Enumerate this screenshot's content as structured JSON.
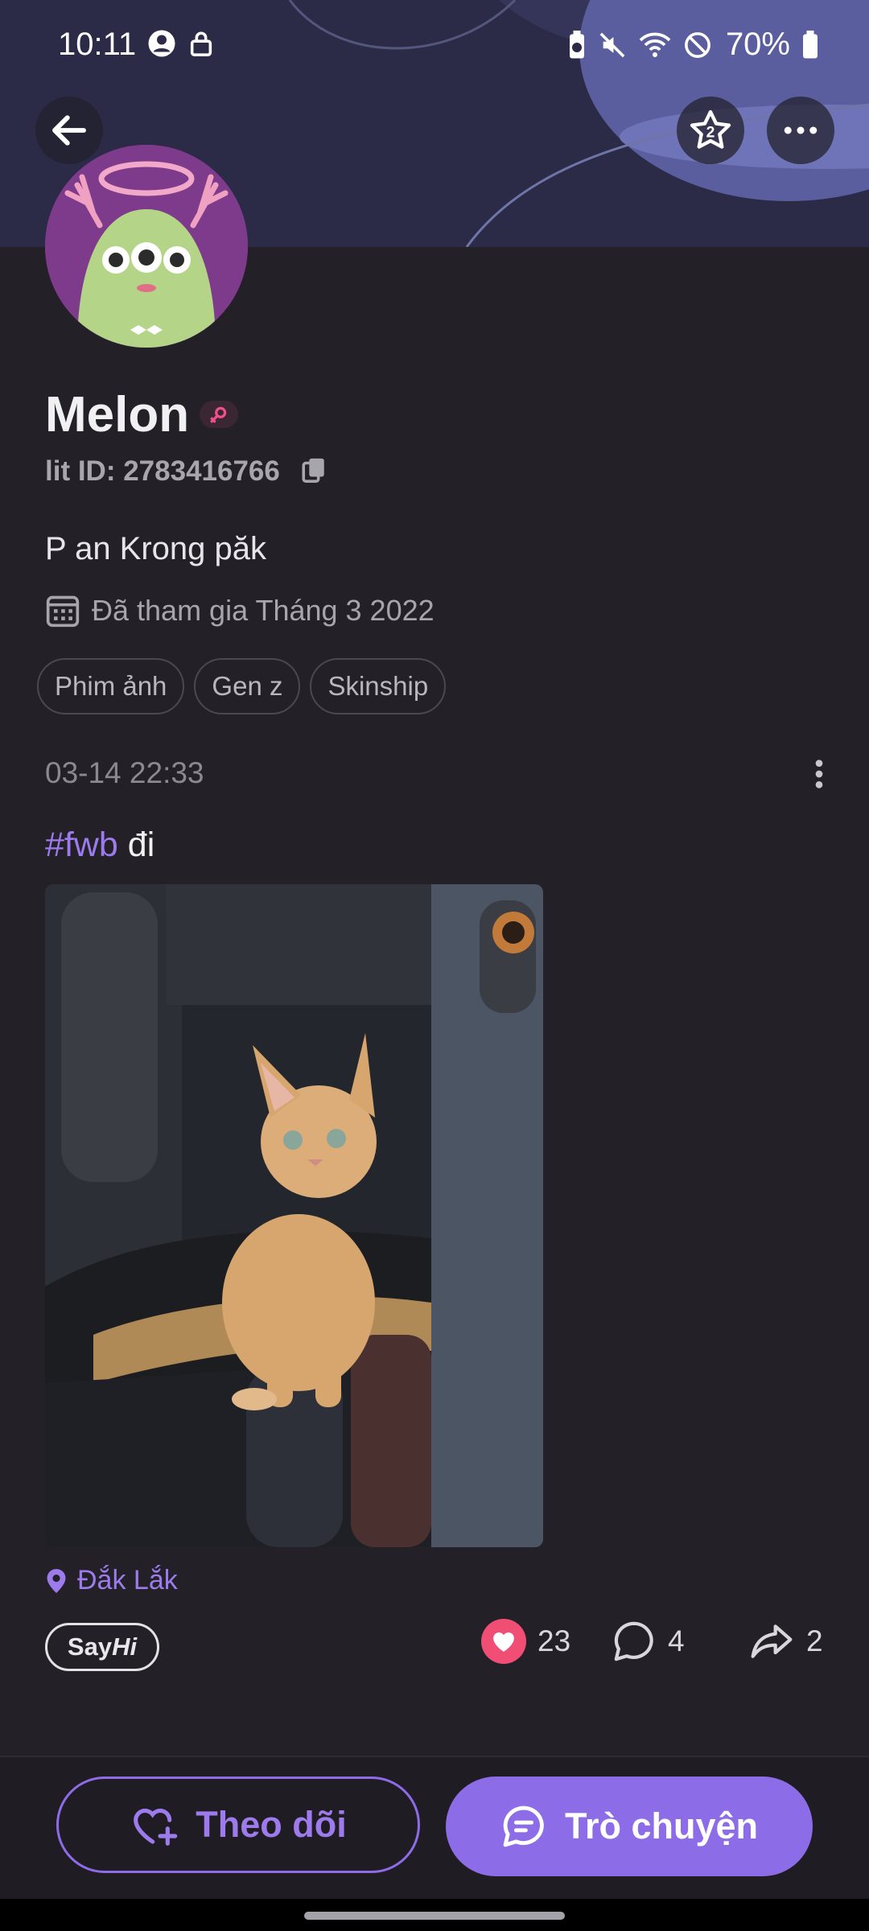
{
  "status_bar": {
    "time": "10:11",
    "battery": "70%"
  },
  "header": {
    "back_icon": "arrow-left-icon",
    "favorite_icon": "star-icon",
    "more_icon": "more-horizontal-icon"
  },
  "profile": {
    "name": "Melon",
    "lit_id": "lit ID: 2783416766",
    "bio": "P an Krong păk",
    "joined": "Đã tham gia Tháng 3 2022",
    "tags": [
      "Phim ảnh",
      "Gen z",
      "Skinship"
    ]
  },
  "post": {
    "date": "03-14 22:33",
    "hashtag": "#fwb",
    "text": " đi",
    "location": "Đắk Lắk",
    "sayhi_say": "Say",
    "sayhi_hi": "Hi",
    "likes": "23",
    "comments": "4",
    "shares": "2"
  },
  "actions": {
    "follow_label": "Theo dõi",
    "chat_label": "Trò chuyện"
  },
  "colors": {
    "accent": "#8d6ce8",
    "like": "#f04e75",
    "background": "#232127"
  }
}
